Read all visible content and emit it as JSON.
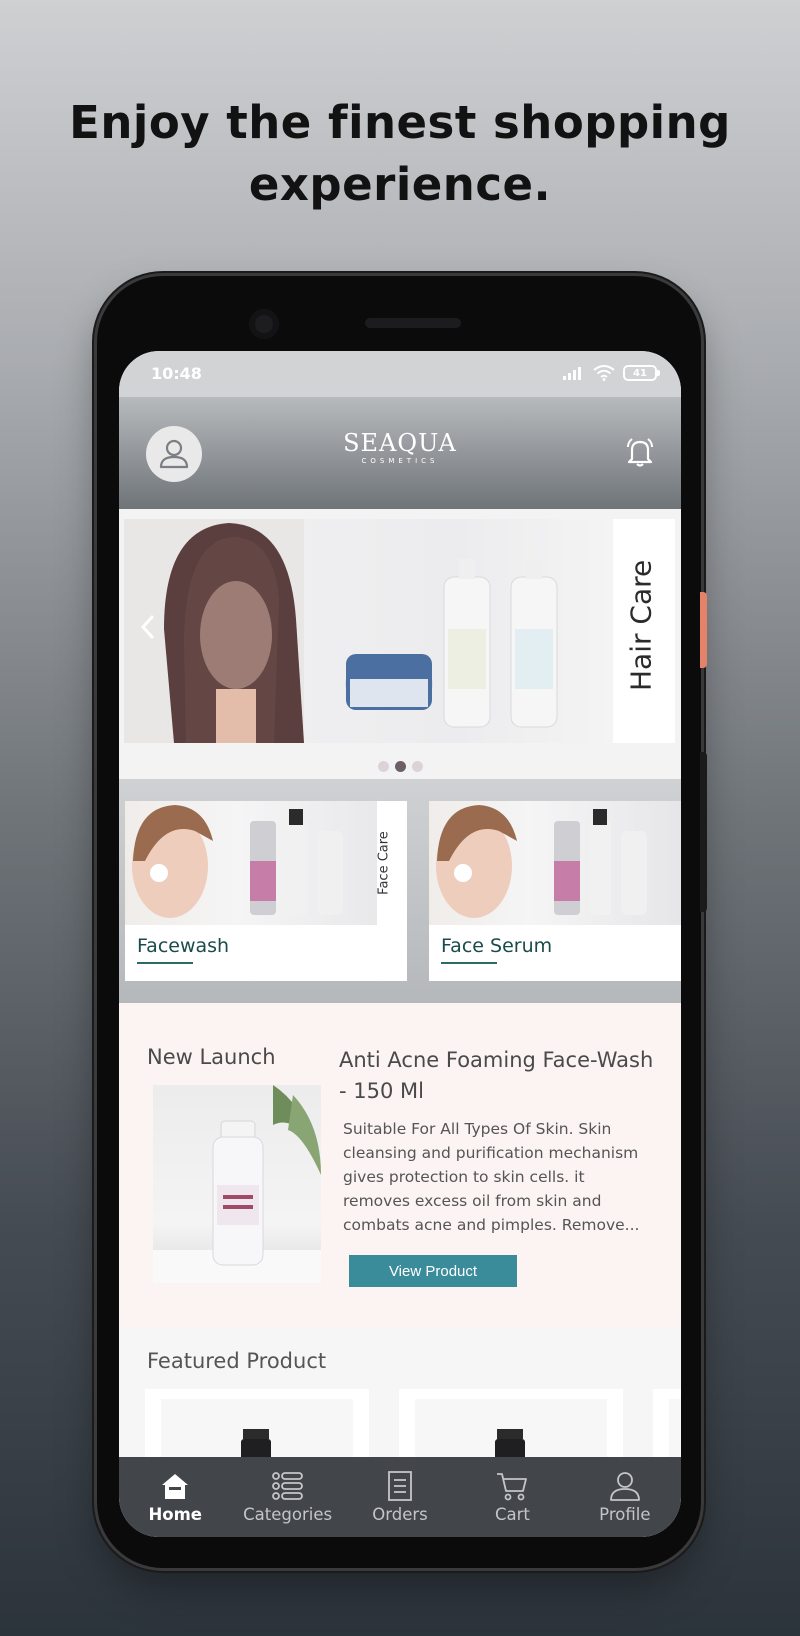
{
  "headline": {
    "line1": "Enjoy the finest shopping",
    "line2": "experience."
  },
  "status_bar": {
    "time": "10:48",
    "battery": "41"
  },
  "app_header": {
    "brand_name": "SEAQUA",
    "brand_sub": "COSMETICS",
    "avatar_icon": "user-icon",
    "bell_icon": "bell-icon"
  },
  "banner": {
    "label": "Hair Care",
    "slide_count": 3,
    "active_slide": 2
  },
  "categories": [
    {
      "name": "Facewash",
      "side_label": "Face Care"
    },
    {
      "name": "Face Serum",
      "side_label": ""
    }
  ],
  "new_launch": {
    "section_title": "New Launch",
    "product_name": "Anti Acne Foaming Face-Wash - 150 Ml",
    "description": "Suitable For All Types Of Skin. Skin cleansing and purification mechanism gives protection to skin cells. it removes excess oil from skin and combats acne and pimples. Remove...",
    "button_label": "View Product"
  },
  "featured": {
    "section_title": "Featured Product"
  },
  "bottom_nav": [
    {
      "label": "Home",
      "icon": "home-icon",
      "active": true
    },
    {
      "label": "Categories",
      "icon": "categories-icon",
      "active": false
    },
    {
      "label": "Orders",
      "icon": "orders-icon",
      "active": false
    },
    {
      "label": "Cart",
      "icon": "cart-icon",
      "active": false
    },
    {
      "label": "Profile",
      "icon": "profile-icon",
      "active": false
    }
  ],
  "colors": {
    "accent_button": "#3a8c9b",
    "nav_background": "#42464b",
    "category_text": "#1b4a4a",
    "launch_background": "#fbf4f2"
  }
}
